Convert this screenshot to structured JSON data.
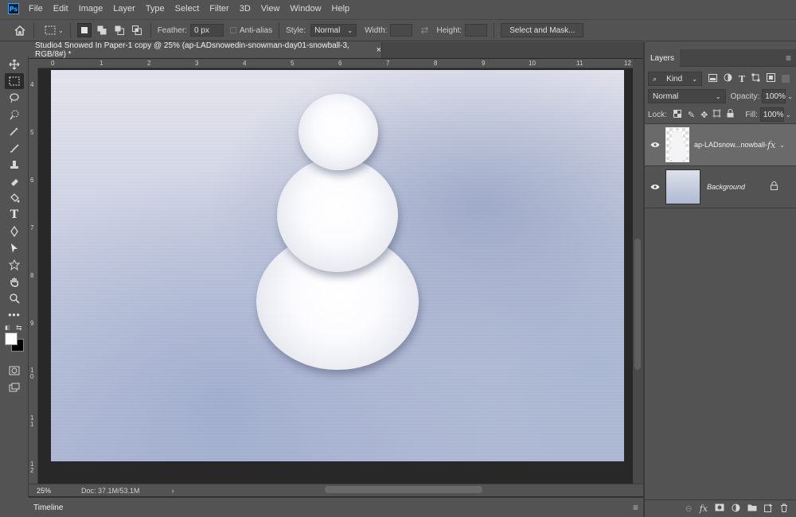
{
  "app": {
    "logo": "Ps"
  },
  "menu": [
    "File",
    "Edit",
    "Image",
    "Layer",
    "Type",
    "Select",
    "Filter",
    "3D",
    "View",
    "Window",
    "Help"
  ],
  "options": {
    "feather_label": "Feather:",
    "feather_value": "0 px",
    "antialias_label": "Anti-alias",
    "style_label": "Style:",
    "style_value": "Normal",
    "width_label": "Width:",
    "height_label": "Height:",
    "select_mask_label": "Select and Mask..."
  },
  "document": {
    "tab_title": "Studio4 Snowed In Paper-1 copy @ 25% (ap-LADsnowedin-snowman-day01-snowball-3, RGB/8#) *",
    "close_glyph": "×",
    "ruler_h": [
      "0",
      "1",
      "2",
      "3",
      "4",
      "5",
      "6",
      "7",
      "8",
      "9",
      "10",
      "11",
      "12"
    ],
    "ruler_v": [
      "4",
      "5",
      "6",
      "7",
      "8",
      "9",
      "1 0",
      "1 1",
      "1 2"
    ],
    "zoom": "25%",
    "doc_size": "Doc: 37.1M/53.1M",
    "status_arrow": "›"
  },
  "timeline": {
    "label": "Timeline"
  },
  "layers_panel": {
    "tab_label": "Layers",
    "filter_kind": "Kind",
    "blend_mode": "Normal",
    "opacity_label": "Opacity:",
    "opacity_value": "100%",
    "lock_label": "Lock:",
    "fill_label": "Fill:",
    "fill_value": "100%",
    "layers": [
      {
        "name": "ap-LADsnow...nowball-3",
        "fx": "fx",
        "selected": true
      },
      {
        "name": "Background",
        "locked": true
      }
    ]
  },
  "colors": {
    "accent": "#31a8ff",
    "panel": "#535353",
    "dark": "#282828",
    "selected_layer": "#6a6a6a"
  }
}
